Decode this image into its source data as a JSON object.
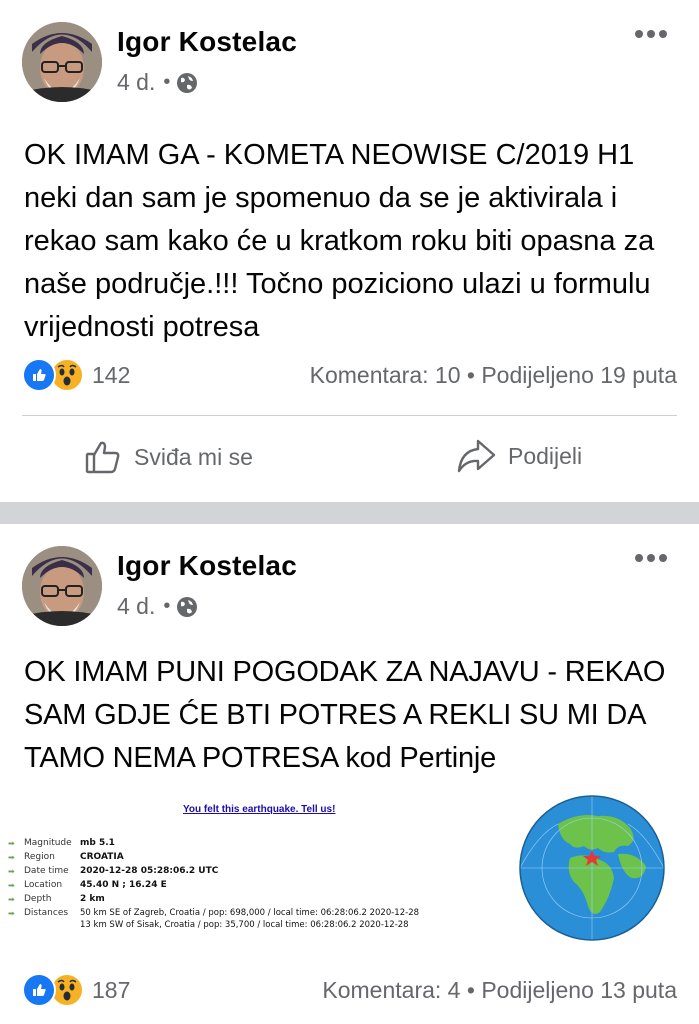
{
  "posts": [
    {
      "author": "Igor Kostelac",
      "time": "4 d.",
      "text": "OK IMAM GA - KOMETA NEOWISE C/2019 H1 neki dan sam je spomenuo da se je aktivirala i rekao sam kako će u kratkom roku biti opasna za naše područje.!!! Točno poziciono ulazi u formulu vrijednosti potresa",
      "reaction_count": "142",
      "comments": "Komentara: 10",
      "shares": "Podijeljeno 19 puta",
      "like_label": "Sviđa mi se",
      "share_label": "Podijeli"
    },
    {
      "author": "Igor Kostelac",
      "time": "4 d.",
      "text": "OK IMAM PUNI POGODAK ZA NAJAVU - REKAO SAM GDJE ĆE BTI POTRES A REKLI SU MI DA TAMO NEMA POTRESA  kod Pertinje",
      "reaction_count": "187",
      "comments": "Komentara: 4",
      "shares": "Podijeljeno 13 puta",
      "earthquake": {
        "link": "You felt this earthquake. Tell us!",
        "rows": [
          {
            "label": "Magnitude",
            "value": "mb 5.1"
          },
          {
            "label": "Region",
            "value": "CROATIA"
          },
          {
            "label": "Date time",
            "value": "2020-12-28 05:28:06.2 UTC"
          },
          {
            "label": "Location",
            "value": "45.40 N ; 16.24 E"
          },
          {
            "label": "Depth",
            "value": "2 km"
          },
          {
            "label": "Distances",
            "value": "50 km SE of Zagreb, Croatia / pop: 698,000 / local time: 06:28:06.2 2020-12-28"
          },
          {
            "label": "",
            "value": "13 km SW of Sisak, Croatia / pop: 35,700 / local time: 06:28:06.2 2020-12-28"
          }
        ]
      }
    }
  ],
  "colors": {
    "like_blue": "#1877f2",
    "wow_yellow": "#f7b125",
    "secondary_text": "#65676b",
    "separator": "#d2d4d7"
  },
  "icons": [
    "globe-icon",
    "more-options-icon",
    "like-reaction-icon",
    "wow-reaction-icon",
    "thumbs-up-icon",
    "share-arrow-icon"
  ]
}
